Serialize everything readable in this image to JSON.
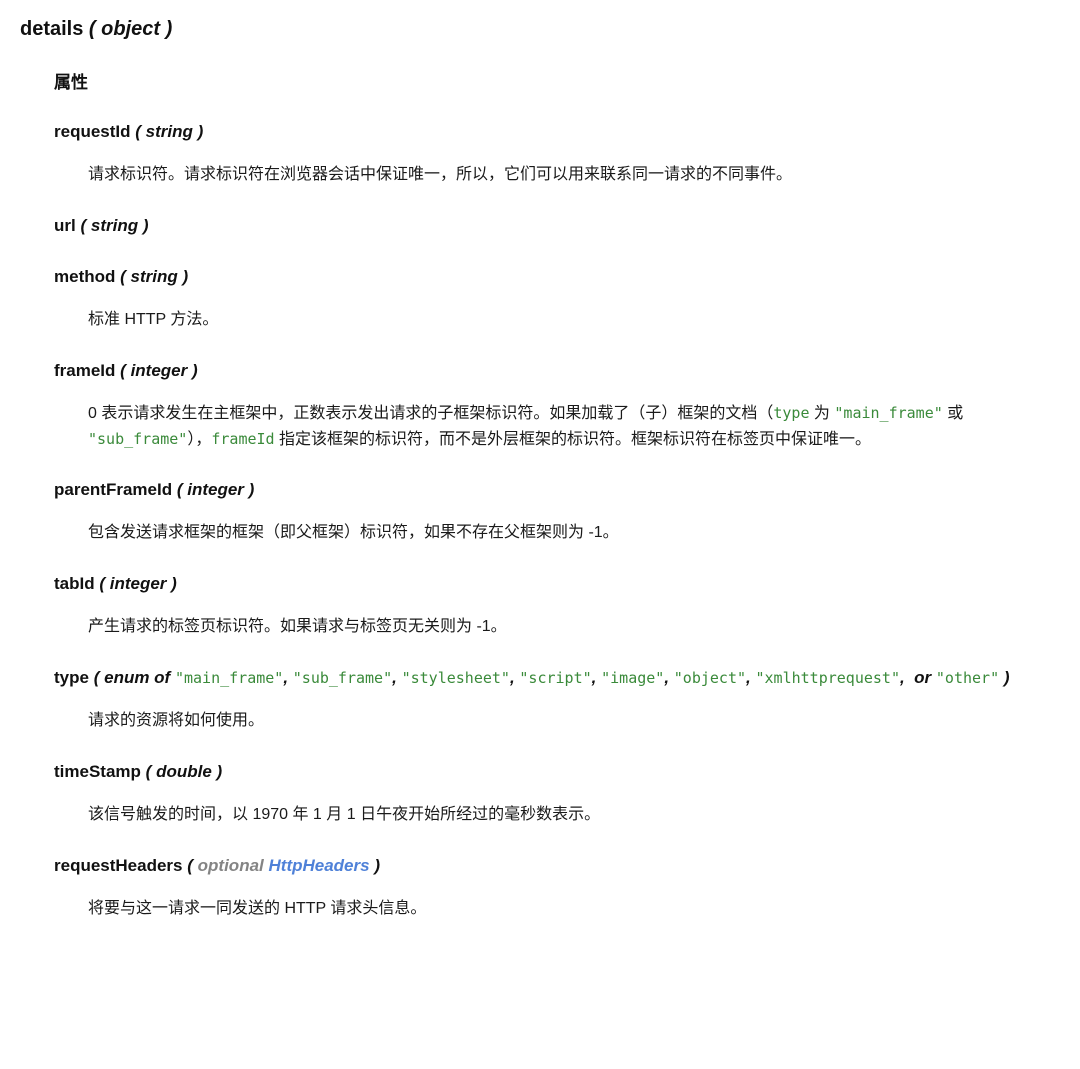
{
  "root": {
    "name": "details",
    "open_paren": "(",
    "type": "object",
    "close_paren": ")"
  },
  "attributes_label": "属性",
  "properties": [
    {
      "name": "requestId",
      "open_paren": "(",
      "type": "string",
      "close_paren": ")",
      "description": "请求标识符。请求标识符在浏览器会话中保证唯一，所以，它们可以用来联系同一请求的不同事件。"
    },
    {
      "name": "url",
      "open_paren": "(",
      "type": "string",
      "close_paren": ")",
      "description": ""
    },
    {
      "name": "method",
      "open_paren": "(",
      "type": "string",
      "close_paren": ")",
      "description": "标准 HTTP 方法。"
    },
    {
      "name": "frameId",
      "open_paren": "(",
      "type": "integer",
      "close_paren": ")",
      "desc_parts": {
        "p1": "0 表示请求发生在主框架中，正数表示发出请求的子框架标识符。如果加载了（子）框架的文档（",
        "code1": "type",
        "p2": " 为 ",
        "code2": "\"main_frame\"",
        "p3": " 或 ",
        "code3": "\"sub_frame\"",
        "p4": "），",
        "code4": "frameId",
        "p5": " 指定该框架的标识符，而不是外层框架的标识符。框架标识符在标签页中保证唯一。"
      }
    },
    {
      "name": "parentFrameId",
      "open_paren": "(",
      "type": "integer",
      "close_paren": ")",
      "description": "包含发送请求框架的框架（即父框架）标识符，如果不存在父框架则为 -1。"
    },
    {
      "name": "tabId",
      "open_paren": "(",
      "type": "integer",
      "close_paren": ")",
      "description": "产生请求的标签页标识符。如果请求与标签页无关则为 -1。"
    },
    {
      "name": "type",
      "open_paren": "(",
      "enum_label": "enum of",
      "enum_values": [
        "\"main_frame\"",
        "\"sub_frame\"",
        "\"stylesheet\"",
        "\"script\"",
        "\"image\"",
        "\"object\"",
        "\"xmlhttprequest\""
      ],
      "enum_or": "or",
      "enum_last": "\"other\"",
      "close_paren": ")",
      "description": "请求的资源将如何使用。"
    },
    {
      "name": "timeStamp",
      "open_paren": "(",
      "type": "double",
      "close_paren": ")",
      "description": "该信号触发的时间，以 1970 年 1 月 1 日午夜开始所经过的毫秒数表示。"
    },
    {
      "name": "requestHeaders",
      "open_paren": "(",
      "optional_label": "optional",
      "link_label": "HttpHeaders",
      "close_paren": ")",
      "description": "将要与这一请求一同发送的 HTTP 请求头信息。"
    }
  ],
  "colors": {
    "code_green": "#3a8a3a",
    "link_blue": "#4f81d8",
    "optional_gray": "#848484",
    "text": "#111111",
    "background": "#ffffff"
  }
}
